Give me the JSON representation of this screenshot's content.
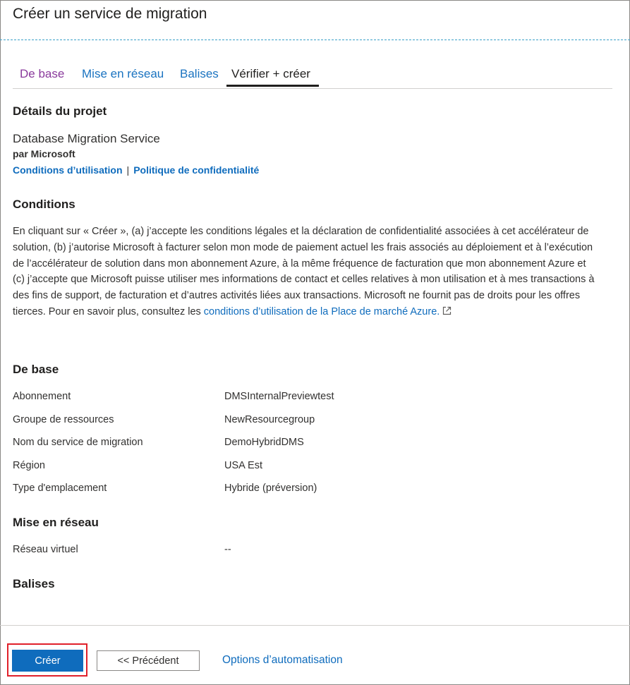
{
  "title": "Créer un service de migration",
  "tabs": [
    {
      "label": "De base"
    },
    {
      "label": "Mise en réseau"
    },
    {
      "label": "Balises"
    },
    {
      "label": "Vérifier + créer",
      "active": true
    }
  ],
  "project": {
    "heading": "Détails du projet",
    "product_name": "Database Migration Service",
    "publisher": "par Microsoft",
    "terms_link": "Conditions d’utilisation",
    "separator": "|",
    "privacy_link": "Politique de confidentialité"
  },
  "conditions": {
    "heading": "Conditions",
    "text": "En cliquant sur « Créer », (a) j’accepte les conditions légales et la déclaration de confidentialité associées à cet accélérateur de solution, (b) j’autorise Microsoft à facturer selon mon mode de paiement actuel les frais associés au déploiement et à l’exécution de l’accélérateur de solution dans mon abonnement Azure, à la même fréquence de facturation que mon abonnement Azure et (c) j’accepte que Microsoft puisse utiliser mes informations de contact et celles relatives à mon utilisation et à mes transactions à des fins de support, de facturation et d’autres activités liées aux transactions. Microsoft ne fournit pas de droits pour les offres tierces. Pour en savoir plus, consultez les ",
    "link": "conditions d’utilisation de la Place de marché Azure."
  },
  "basics": {
    "heading": "De base",
    "rows": [
      {
        "label": "Abonnement",
        "value": "DMSInternalPreviewtest"
      },
      {
        "label": "Groupe de ressources",
        "value": "NewResourcegroup"
      },
      {
        "label": "Nom du service de migration",
        "value": "DemoHybridDMS"
      },
      {
        "label": "Région",
        "value": "USA Est"
      },
      {
        "label": "Type d'emplacement",
        "value": "Hybride (préversion)"
      }
    ]
  },
  "networking": {
    "heading": "Mise en réseau",
    "rows": [
      {
        "label": "Réseau virtuel",
        "value": "--"
      }
    ]
  },
  "tags": {
    "heading": "Balises"
  },
  "footer": {
    "create_label": "Créer",
    "previous_label": "<< Précédent",
    "automation_label": "Options d’automatisation"
  },
  "colors": {
    "accent": "#0f6cbd",
    "visited_tab": "#8a3a9c",
    "highlight": "#e0202a"
  }
}
